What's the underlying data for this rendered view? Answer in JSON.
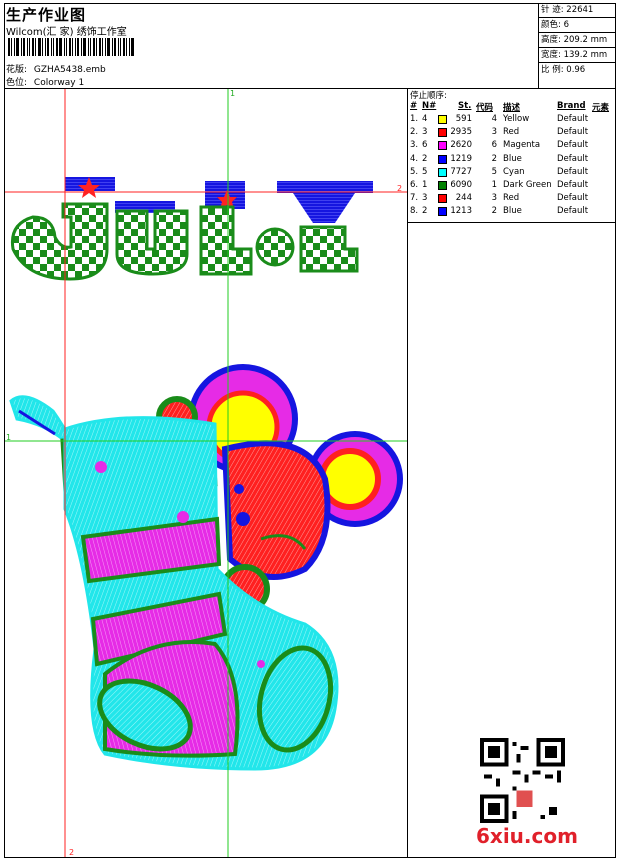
{
  "header": {
    "title": "生产作业图",
    "software": "Wilcom(汇 家) 绣饰工作室",
    "design_label": "花版:",
    "design_value": "GZHA5438.emb",
    "color_label": "色位:",
    "color_value": "Colorway 1"
  },
  "stats": [
    {
      "label": "针 迹:",
      "value": "22641"
    },
    {
      "label": "颜色:",
      "value": "6"
    },
    {
      "label": "高度:",
      "value": "209.2 mm"
    },
    {
      "label": "宽度:",
      "value": "139.2 mm"
    },
    {
      "label": "比 例:",
      "value": "0.96"
    }
  ],
  "stop_sequence": {
    "label": "停止顺序:",
    "columns": [
      "#",
      "N#",
      "St.",
      "代码",
      "描述",
      "Brand",
      "元素"
    ],
    "rows": [
      {
        "idx": "1.",
        "n": "4",
        "color": "#ffff00",
        "st": "591",
        "code": "4",
        "desc": "Yellow",
        "brand": "Default"
      },
      {
        "idx": "2.",
        "n": "3",
        "color": "#ff0000",
        "st": "2935",
        "code": "3",
        "desc": "Red",
        "brand": "Default"
      },
      {
        "idx": "3.",
        "n": "6",
        "color": "#ff00ff",
        "st": "2620",
        "code": "6",
        "desc": "Magenta",
        "brand": "Default"
      },
      {
        "idx": "4.",
        "n": "2",
        "color": "#0000ff",
        "st": "1219",
        "code": "2",
        "desc": "Blue",
        "brand": "Default"
      },
      {
        "idx": "5.",
        "n": "5",
        "color": "#00ffff",
        "st": "7727",
        "code": "5",
        "desc": "Cyan",
        "brand": "Default"
      },
      {
        "idx": "6.",
        "n": "1",
        "color": "#008000",
        "st": "6090",
        "code": "1",
        "desc": "Dark Green",
        "brand": "Default"
      },
      {
        "idx": "7.",
        "n": "3",
        "color": "#ff0000",
        "st": "244",
        "code": "3",
        "desc": "Red",
        "brand": "Default"
      },
      {
        "idx": "8.",
        "n": "2",
        "color": "#0000ff",
        "st": "1213",
        "code": "2",
        "desc": "Blue",
        "brand": "Default"
      }
    ]
  },
  "guides": {
    "v1": "1",
    "v2": "2",
    "h1": "1",
    "h2": "2"
  },
  "watermark": "6xiu.com"
}
